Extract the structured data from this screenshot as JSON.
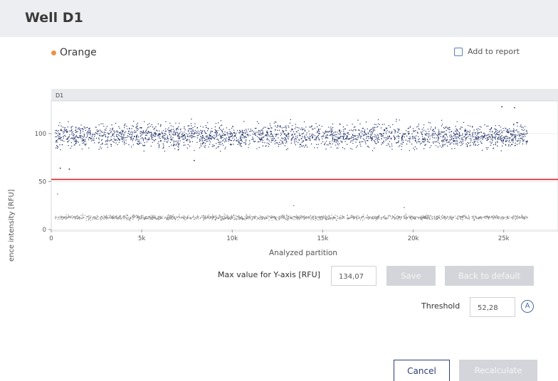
{
  "header": {
    "title": "Well D1"
  },
  "channel": {
    "name": "Orange",
    "color": "#e99449"
  },
  "report": {
    "label": "Add to report",
    "checked": false
  },
  "chart_data": {
    "type": "scatter",
    "panel_title": "D1",
    "xlabel": "Analyzed partition",
    "ylabel": "Fluorescence intensity [RFU]",
    "xlim": [
      0,
      28000
    ],
    "ylim": [
      0,
      134.07
    ],
    "x_ticks": [
      {
        "value": 0,
        "label": "0"
      },
      {
        "value": 5000,
        "label": "5k"
      },
      {
        "value": 10000,
        "label": "10k"
      },
      {
        "value": 15000,
        "label": "15k"
      },
      {
        "value": 20000,
        "label": "20k"
      },
      {
        "value": 25000,
        "label": "25k"
      }
    ],
    "y_ticks": [
      {
        "value": 0,
        "label": "0"
      },
      {
        "value": 50,
        "label": "50"
      },
      {
        "value": 100,
        "label": "100"
      }
    ],
    "threshold": 52.28,
    "series": [
      {
        "color": "#1f2f66",
        "x_range": [
          200,
          26300
        ],
        "mean": 98,
        "spread": 6,
        "max_partition": 26300
      },
      {
        "color": "#8f8f8f",
        "x_range": [
          200,
          26300
        ],
        "mean": 13,
        "spread": 1.2,
        "max_partition": 26300
      }
    ],
    "outliers": [
      {
        "x": 500,
        "y": 64,
        "color": "#1f2f66"
      },
      {
        "x": 1000,
        "y": 63,
        "color": "#1f2f66"
      },
      {
        "x": 7900,
        "y": 72,
        "color": "#1f2f66"
      },
      {
        "x": 24900,
        "y": 128,
        "color": "#1f2f66"
      },
      {
        "x": 25600,
        "y": 127,
        "color": "#1f2f66"
      },
      {
        "x": 350,
        "y": 37,
        "color": "#8f8f8f"
      },
      {
        "x": 13400,
        "y": 25,
        "color": "#8f8f8f"
      },
      {
        "x": 19500,
        "y": 23,
        "color": "#8f8f8f"
      }
    ]
  },
  "controls": {
    "ymax_label": "Max value for Y-axis [RFU]",
    "ymax_value": "134,07",
    "save_label": "Save",
    "default_label": "Back to default",
    "threshold_label": "Threshold",
    "threshold_value": "52,28",
    "auto_icon": "A"
  },
  "footer": {
    "cancel_label": "Cancel",
    "recalculate_label": "Recalculate"
  }
}
